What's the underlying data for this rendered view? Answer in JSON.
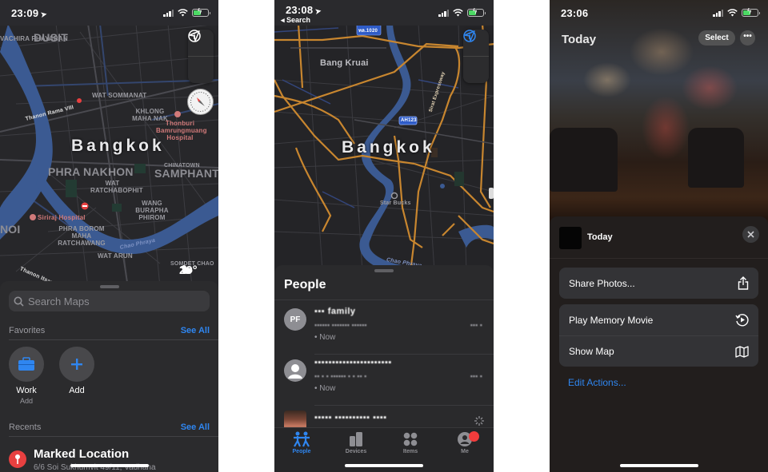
{
  "phones": {
    "maps": {
      "status": {
        "time": "23:09"
      },
      "map": {
        "city_label": "Bangkok",
        "districts": [
          "DUSIT",
          "PHRA NAKHON",
          "SAMPHANT",
          "NOI"
        ],
        "areas": [
          "VACHIRA PHAYABAN",
          "WAT SOMMANAT",
          "KHLONG MAHA NAK",
          "WAT RATCHABOPHIT",
          "WANG BURAPHA PHIROM",
          "PHRA BOROM MAHA RATCHAWANG",
          "WAT ARUN",
          "CHINATOWN",
          "SOMDET CHAO"
        ],
        "pois": [
          "Thonburi Bamrungmuang Hospital",
          "Siriraj Hospital"
        ],
        "roads": [
          "Thanon Rama VIII",
          "Thanon Itsaraphap",
          "Chao Phraya"
        ],
        "weather": {
          "icon": "partly-cloudy-icon",
          "temp": "29°"
        }
      },
      "search": {
        "placeholder": "Search Maps"
      },
      "favorites": {
        "heading": "Favorites",
        "see_all": "See All",
        "items": [
          {
            "name": "Work",
            "sub": "Add",
            "icon": "briefcase-icon"
          },
          {
            "name": "Add",
            "sub": "",
            "icon": "plus-icon"
          }
        ]
      },
      "recents": {
        "heading": "Recents",
        "see_all": "See All",
        "items": [
          {
            "title": "Marked Location",
            "address": "6/6 Soi Sukhumvit 49/11, Vadhana"
          }
        ]
      }
    },
    "findmy": {
      "status": {
        "time": "23:08",
        "back_label": "◂ Search"
      },
      "map": {
        "city_label": "Bangkok",
        "labels": [
          "Bang Kruai",
          "Star Bucks",
          "Sirat Expressway",
          "Chao Phraya"
        ],
        "route_shields": [
          "ทล.1020",
          "AH123"
        ]
      },
      "people": {
        "title": "People",
        "list": [
          {
            "initials": "PF",
            "name": "▪▪▪ family",
            "location": "▪▪▪▪▪▪ ▪▪▪▪▪▪▪ ▪▪▪▪▪▪",
            "distance": "▪▪▪ ▪",
            "time": "• Now"
          },
          {
            "initials": "",
            "name": "▪▪▪▪▪▪▪▪▪▪▪▪▪▪▪▪▪▪▪▪▪▪",
            "location": "▪▪ ▪ ▪ ▪▪▪▪▪▪ ▪ ▪ ▪▪ ▪",
            "distance": "▪▪▪ ▪",
            "time": "• Now"
          },
          {
            "initials": "",
            "name": "▪▪▪▪▪ ▪▪▪▪▪▪▪▪▪▪ ▪▪▪▪",
            "location": "",
            "distance": "",
            "time": ""
          }
        ]
      },
      "tabs": [
        {
          "label": "People",
          "icon": "people-icon",
          "active": true
        },
        {
          "label": "Devices",
          "icon": "devices-icon",
          "active": false
        },
        {
          "label": "Items",
          "icon": "items-icon",
          "active": false
        },
        {
          "label": "Me",
          "icon": "me-icon",
          "active": false
        }
      ]
    },
    "photos": {
      "status": {
        "time": "23:06"
      },
      "header": {
        "title": "Today",
        "select_label": "Select",
        "more_label": "•••"
      },
      "action_sheet": {
        "title": "Today",
        "groups": [
          [
            {
              "label": "Share Photos...",
              "icon": "share-icon"
            }
          ],
          [
            {
              "label": "Play Memory Movie",
              "icon": "play-memory-icon"
            },
            {
              "label": "Show Map",
              "icon": "map-icon"
            }
          ]
        ],
        "edit_actions": "Edit Actions..."
      }
    }
  },
  "colors": {
    "accent": "#2f86f0",
    "danger": "#e84040",
    "road_orange": "#c8862f",
    "river": "#3b5a92"
  }
}
